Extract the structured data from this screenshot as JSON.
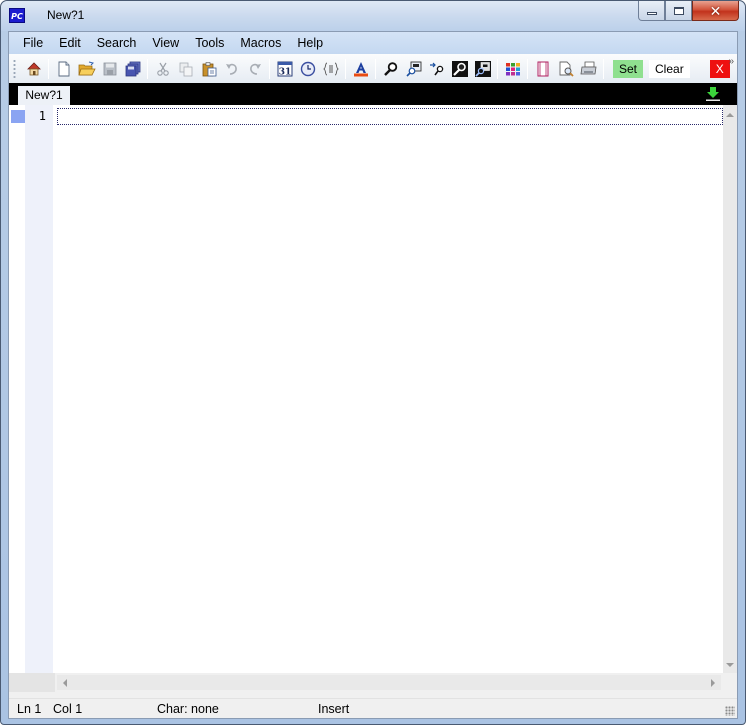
{
  "window": {
    "title": "New?1",
    "app_icon_label": "PC",
    "controls": {
      "minimize": "minimize",
      "maximize": "maximize",
      "close": "✕"
    }
  },
  "menu": {
    "items": [
      {
        "label": "File"
      },
      {
        "label": "Edit"
      },
      {
        "label": "Search"
      },
      {
        "label": "View"
      },
      {
        "label": "Tools"
      },
      {
        "label": "Macros"
      },
      {
        "label": "Help"
      }
    ]
  },
  "toolbar": {
    "icons": [
      "home-icon",
      "new-file-icon",
      "open-folder-icon",
      "save-icon",
      "save-all-icon",
      "cut-icon",
      "copy-icon",
      "paste-icon",
      "undo-icon",
      "redo-icon",
      "calendar-icon",
      "clock-icon",
      "code-block-icon",
      "font-color-icon",
      "find-icon",
      "find-in-files-icon",
      "find-next-icon",
      "find-replace-icon",
      "replace-in-files-icon",
      "color-palette-icon",
      "page-setup-icon",
      "print-preview-icon",
      "print-icon"
    ],
    "calendar_day": "31",
    "set_label": "Set",
    "clear_label": "Clear",
    "x_label": "X",
    "overflow_label": "»",
    "colors": {
      "set": "#8fe08f",
      "x": "#ee1010"
    }
  },
  "tabs": [
    {
      "label": "New?1",
      "active": true
    }
  ],
  "editor": {
    "line_numbers": [
      "1"
    ],
    "content": ""
  },
  "statusbar": {
    "line": "Ln 1",
    "column": "Col 1",
    "char": "Char: none",
    "mode": "Insert"
  }
}
